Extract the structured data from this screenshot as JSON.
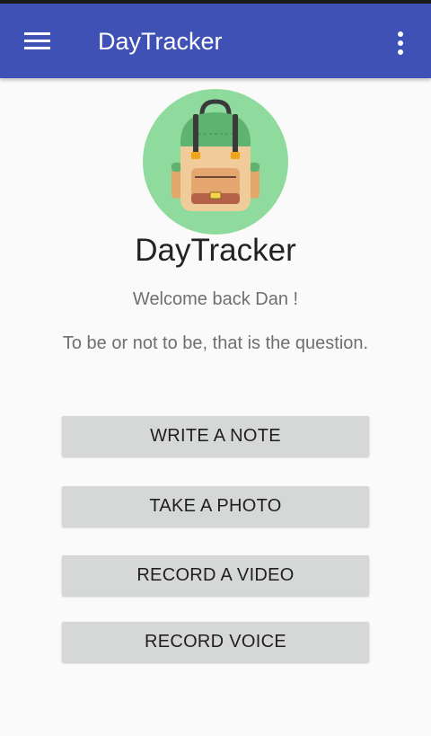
{
  "app_bar": {
    "title": "DayTracker",
    "menu_icon": "hamburger-menu-icon",
    "overflow_icon": "more-vert-icon",
    "color": "#3f51b5"
  },
  "main": {
    "logo_icon": "backpack-icon",
    "heading": "DayTracker",
    "welcome": "Welcome back Dan !",
    "quote": "To be or not to be, that is the question."
  },
  "actions": {
    "write_note": "WRITE A NOTE",
    "take_photo": "TAKE A PHOTO",
    "record_video": "RECORD A VIDEO",
    "record_voice": "RECORD VOICE"
  }
}
